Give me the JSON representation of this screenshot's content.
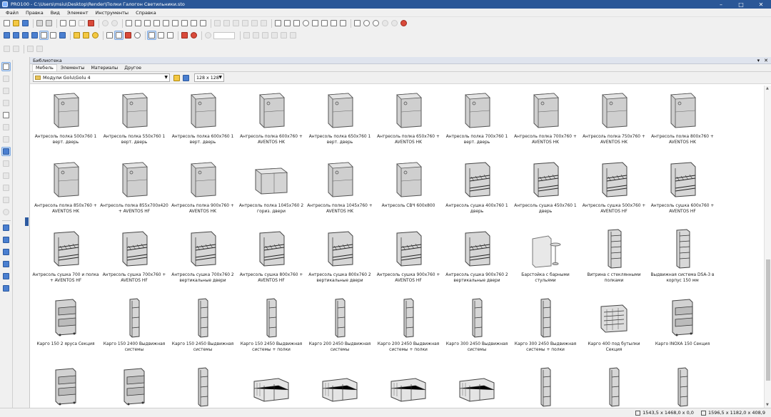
{
  "window": {
    "title": "PRO100 - C:\\Users\\msiu\\Desktop\\Render\\Полки Галогон Светильники.sto",
    "buttons": [
      "–",
      "□",
      "✕"
    ]
  },
  "menu": [
    "Файл",
    "Правка",
    "Вид",
    "Элемент",
    "Инструменты",
    "Справка"
  ],
  "library": {
    "title": "Библиотека",
    "header_buttons": [
      "▾",
      "✕"
    ],
    "tabs": [
      "Мебель",
      "Элементы",
      "Материалы",
      "Другое"
    ],
    "selected_tab": "Мебель",
    "path": "Модули Golu\\Golu 4",
    "thumb_size": "128 x 128"
  },
  "items": [
    "Антресоль полка 500х760 1\nверт. дверь",
    "Антресоль полка 550х760 1\nверт. дверь",
    "Антресоль полка 600х760 1\nверт. дверь",
    "Антресоль полка 600х760 +\nAVENTOS HK",
    "Антресоль полка 650х760 1\nверт. дверь",
    "Антресоль полка 650х760 +\nAVENTOS HK",
    "Антресоль полка 700х760 1\nверт. дверь",
    "Антресоль полка 700х760 +\nAVENTOS HK",
    "Антресоль полка 750х760 +\nAVENTOS HK",
    "Антресоль полка 800х760 +\nAVENTOS HK",
    "Антресоль полка 850х760 +\nAVENTOS HK",
    "Антресоль полка 855х700х420\n+ AVENTOS HF",
    "Антресоль полка 900х760 +\nAVENTOS HK",
    "Антресоль полка 1045х760 2\nгориз. двери",
    "Антресоль полка 1045х760 +\nAVENTOS HK",
    "Антресоль СВЧ 600х800",
    "Антресоль сушка 400х760 1\nдверь",
    "Антресоль сушка 450х760 1\nдверь",
    "Антресоль сушка 500х760 +\nAVENTOS HF",
    "Антресоль сушка 600х760 +\nAVENTOS HF",
    "Антресоль сушка 700 и полка\n+ AVENTOS HF",
    "Антресоль сушка 700х760 +\nAVENTOS HF",
    "Антресоль сушка 700х760 2\nвертикальные двери",
    "Антресоль сушка 800х760 +\nAVENTOS HF",
    "Антресоль сушка 800х760 2\nвертикальные двери",
    "Антресоль сушка 900х760 +\nAVENTOS HF",
    "Антресоль сушка 900х760 2\nвертикальные двери",
    "Барстойка с барными\nстульями",
    "Витрина с стеклянными\nполками",
    "Выдвижная система DSA-3 в\nкорпус 150 мм",
    "Карго 150 2 яруса Секция",
    "Карго 150 2400 Выдвижная\nсистемы",
    "Карго 150 2450 Выдвижная\nсистемы",
    "Карго 150 2450 Выдвижная\nсистемы + полки",
    "Карго 200 2450 Выдвижная\nсистемы",
    "Карго 200 2450 Выдвижная\nсистемы + полки",
    "Карго 300 2450 Выдвижная\nсистемы",
    "Карго 300 2450 Выдвижная\nсистемы + полки",
    "Карго 400 под бутылки Секция",
    "Карго INOXA 150 Секция",
    "",
    "",
    "",
    "",
    "",
    "",
    "",
    "",
    "",
    ""
  ],
  "status": {
    "coords1": "1543,5 x 1468,0 x 0,0",
    "coords2": "1596,5 x 1182,0 x 408,9"
  }
}
